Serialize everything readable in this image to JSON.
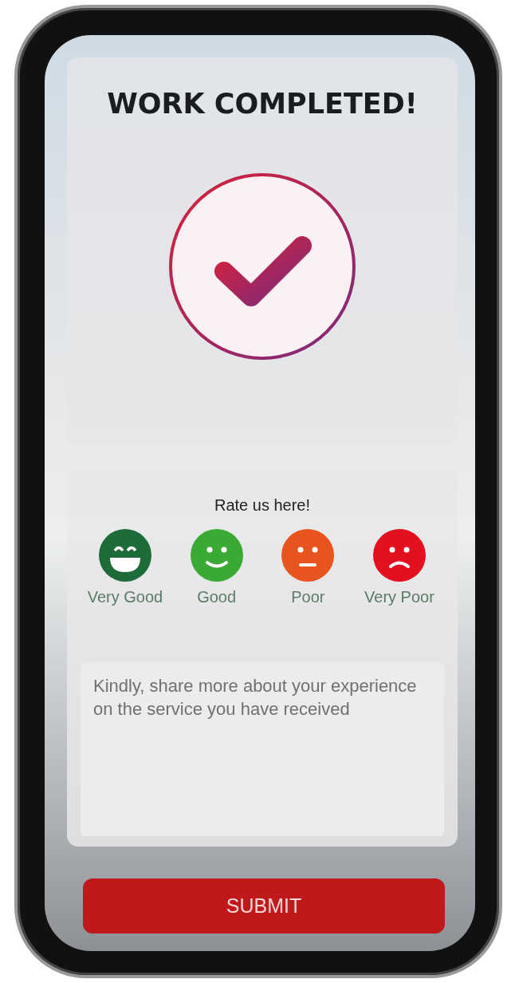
{
  "title": "WORK COMPLETED!",
  "rating": {
    "prompt": "Rate us here!",
    "options": [
      {
        "label": "Very Good",
        "kind": "laugh",
        "color": "#1e6b3a"
      },
      {
        "label": "Good",
        "kind": "smile",
        "color": "#3aaa35"
      },
      {
        "label": "Poor",
        "kind": "neutral",
        "color": "#e8541e"
      },
      {
        "label": "Very Poor",
        "kind": "sad",
        "color": "#e3101f"
      }
    ]
  },
  "feedback": {
    "placeholder": "Kindly, share more about your experience on the service you have received"
  },
  "submit": "SUBMIT"
}
